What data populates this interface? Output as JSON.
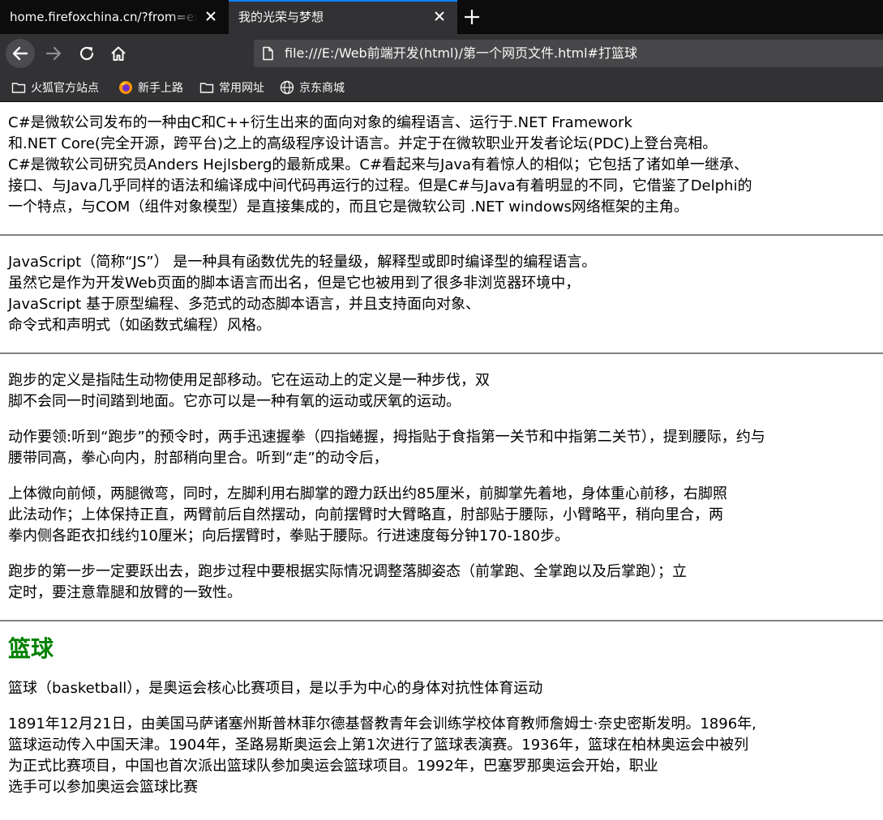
{
  "browser": {
    "tabs": [
      {
        "title": "home.firefoxchina.cn/?from=extra_start",
        "active": false
      },
      {
        "title": "我的光荣与梦想",
        "active": true
      }
    ],
    "url": "file:///E:/Web前端开发(html)/第一个网页文件.html#打篮球",
    "bookmarks": [
      {
        "label": "火狐官方站点",
        "icon": "folder-icon"
      },
      {
        "label": "新手上路",
        "icon": "firefox-icon"
      },
      {
        "label": "常用网址",
        "icon": "folder-icon"
      },
      {
        "label": "京东商城",
        "icon": "globe-icon"
      }
    ],
    "colors": {
      "tabbar": "#0c0c0d",
      "toolbar": "#323234",
      "urlbar": "#474749",
      "accent": "#0a84ff"
    }
  },
  "content": {
    "csharp": [
      "C#是微软公司发布的一种由C和C++衍生出来的面向对象的编程语言、运行于.NET Framework",
      "和.NET Core(完全开源，跨平台)之上的高级程序设计语言。并定于在微软职业开发者论坛(PDC)上登台亮相。",
      "C#是微软公司研究员Anders Hejlsberg的最新成果。C#看起来与Java有着惊人的相似；它包括了诸如单一继承、",
      "接口、与Java几乎同样的语法和编译成中间代码再运行的过程。但是C#与Java有着明显的不同，它借鉴了Delphi的",
      "一个特点，与COM（组件对象模型）是直接集成的，而且它是微软公司 .NET windows网络框架的主角。"
    ],
    "javascript": [
      "JavaScript（简称“JS”） 是一种具有函数优先的轻量级，解释型或即时编译型的编程语言。",
      "虽然它是作为开发Web页面的脚本语言而出名，但是它也被用到了很多非浏览器环境中，",
      "JavaScript 基于原型编程、多范式的动态脚本语言，并且支持面向对象、",
      "命令式和声明式（如函数式编程）风格。"
    ],
    "running": [
      [
        "跑步的定义是指陆生动物使用足部移动。它在运动上的定义是一种步伐，双",
        "脚不会同一时间踏到地面。它亦可以是一种有氧的运动或厌氧的运动。"
      ],
      [
        "动作要领:听到“跑步”的预令时，两手迅速握拳（四指蜷握，拇指贴于食指第一关节和中指第二关节），提到腰际，约与",
        "腰带同高，拳心向内，肘部稍向里合。听到“走”的动令后，"
      ],
      [
        "上体微向前倾，两腿微弯，同时，左脚利用右脚掌的蹬力跃出约85厘米，前脚掌先着地，身体重心前移，右脚照",
        "此法动作；上体保持正直，两臂前后自然摆动，向前摆臂时大臂略直，肘部贴于腰际，小臂略平，稍向里合，两",
        "拳内侧各距衣扣线约10厘米；向后摆臂时，拳贴于腰际。行进速度每分钟170-180步。"
      ],
      [
        "跑步的第一步一定要跃出去，跑步过程中要根据实际情况调整落脚姿态（前掌跑、全掌跑以及后掌跑）；立",
        "定时，要注意靠腿和放臂的一致性。"
      ]
    ],
    "basketball": {
      "heading": "篮球",
      "heading_color": "#008000",
      "paragraphs": [
        [
          "篮球（basketball），是奥运会核心比赛项目，是以手为中心的身体对抗性体育运动"
        ],
        [
          "1891年12月21日，由美国马萨诸塞州斯普林菲尔德基督教青年会训练学校体育教师詹姆士·奈史密斯发明。1896年,",
          "篮球运动传入中国天津。1904年，圣路易斯奥运会上第1次进行了篮球表演赛。1936年，篮球在柏林奥运会中被列",
          "为正式比赛项目，中国也首次派出篮球队参加奥运会篮球项目。1992年，巴塞罗那奥运会开始，职业",
          "选手可以参加奥运会篮球比赛"
        ]
      ]
    }
  }
}
